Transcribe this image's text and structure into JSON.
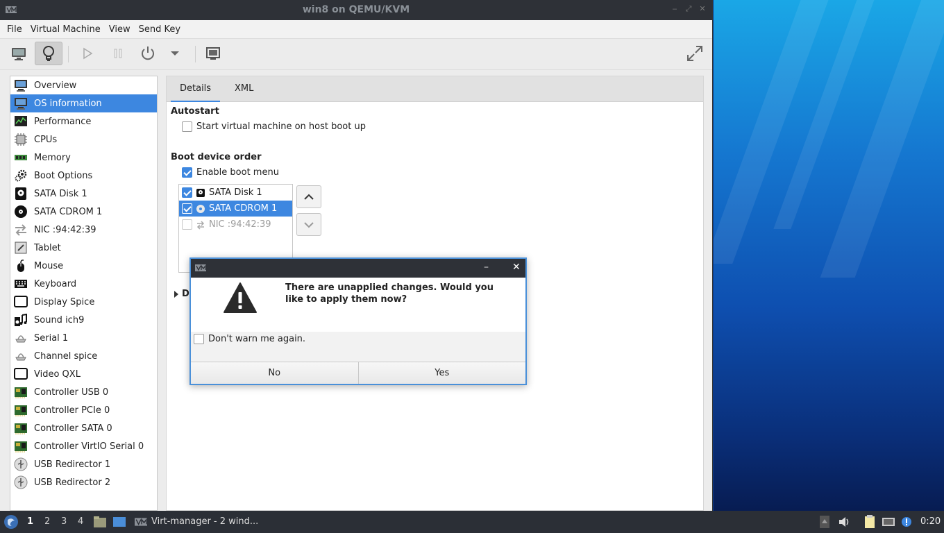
{
  "window": {
    "title": "win8 on QEMU/KVM"
  },
  "menubar": [
    "File",
    "Virtual Machine",
    "View",
    "Send Key"
  ],
  "sidebar": {
    "items": [
      {
        "label": "Overview",
        "icon": "monitor-icon"
      },
      {
        "label": "OS information",
        "icon": "monitor-icon",
        "selected": true
      },
      {
        "label": "Performance",
        "icon": "performance-graph-icon"
      },
      {
        "label": "CPUs",
        "icon": "cpu-chip-icon"
      },
      {
        "label": "Memory",
        "icon": "memory-module-icon"
      },
      {
        "label": "Boot Options",
        "icon": "gears-icon"
      },
      {
        "label": "SATA Disk 1",
        "icon": "disk-icon"
      },
      {
        "label": "SATA CDROM 1",
        "icon": "cdrom-icon"
      },
      {
        "label": "NIC :94:42:39",
        "icon": "network-arrows-icon"
      },
      {
        "label": "Tablet",
        "icon": "tablet-icon"
      },
      {
        "label": "Mouse",
        "icon": "mouse-icon"
      },
      {
        "label": "Keyboard",
        "icon": "keyboard-icon"
      },
      {
        "label": "Display Spice",
        "icon": "display-icon"
      },
      {
        "label": "Sound ich9",
        "icon": "sound-icon"
      },
      {
        "label": "Serial 1",
        "icon": "serial-icon"
      },
      {
        "label": "Channel spice",
        "icon": "serial-icon"
      },
      {
        "label": "Video QXL",
        "icon": "display-icon"
      },
      {
        "label": "Controller USB 0",
        "icon": "controller-card-icon"
      },
      {
        "label": "Controller PCIe 0",
        "icon": "controller-card-icon"
      },
      {
        "label": "Controller SATA 0",
        "icon": "controller-card-icon"
      },
      {
        "label": "Controller VirtIO Serial 0",
        "icon": "controller-card-icon"
      },
      {
        "label": "USB Redirector 1",
        "icon": "usb-icon"
      },
      {
        "label": "USB Redirector 2",
        "icon": "usb-icon"
      }
    ]
  },
  "details": {
    "tabs": [
      "Details",
      "XML"
    ],
    "autostart_title": "Autostart",
    "autostart_label": "Start virtual machine on host boot up",
    "boot_order_title": "Boot device order",
    "enable_boot_menu": "Enable boot menu",
    "boot_devices": [
      {
        "label": "SATA Disk 1",
        "checked": true,
        "icon": "disk-icon"
      },
      {
        "label": "SATA CDROM 1",
        "checked": true,
        "icon": "cdrom-icon",
        "selected": true
      },
      {
        "label": "NIC :94:42:39",
        "checked": false,
        "icon": "network-arrows-icon"
      }
    ],
    "collapsed_section_letter": "D"
  },
  "dialog": {
    "message": "There are unapplied changes. Would you like to apply them now?",
    "dont_warn": "Don't warn me again.",
    "no_label": "No",
    "yes_label": "Yes"
  },
  "taskbar": {
    "workspaces": [
      "1",
      "2",
      "3",
      "4"
    ],
    "task_label": "Virt-manager - 2 wind...",
    "clock": "0:20"
  },
  "colors": {
    "accent": "#3d87e0",
    "titlebar": "#2e3137",
    "taskbar": "#2b2f36"
  }
}
